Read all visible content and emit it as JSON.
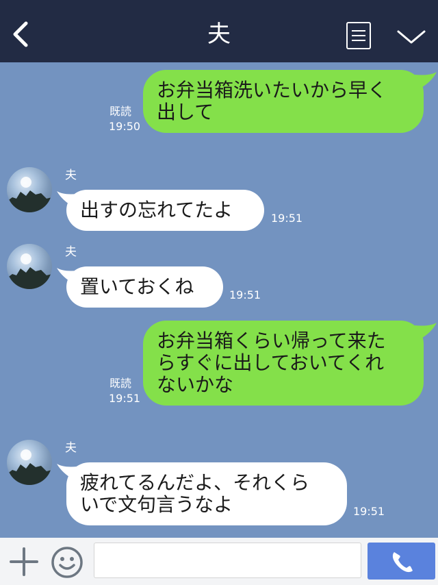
{
  "header": {
    "title": "夫",
    "back_icon": "chevron-left-icon",
    "menu_icon": "list-icon",
    "collapse_icon": "chevron-down-icon",
    "background": "#222b44"
  },
  "messages": [
    {
      "from": "me",
      "text": "お弁当箱洗いたいから早く\n出して",
      "read_label": "既読",
      "time": "19:50"
    },
    {
      "from": "husband",
      "sender": "夫",
      "text": "出すの忘れてたよ",
      "time": "19:51"
    },
    {
      "from": "husband",
      "sender": "夫",
      "text": "置いておくね",
      "time": "19:51"
    },
    {
      "from": "me",
      "text": "お弁当箱くらい帰って来た\nらすぐに出しておいてくれ\nないかな",
      "read_label": "既読",
      "time": "19:51"
    },
    {
      "from": "husband",
      "sender": "夫",
      "text": "疲れてるんだよ、それくら\nいで文句言うなよ",
      "time": "19:51"
    }
  ],
  "input_bar": {
    "plus_icon": "plus-icon",
    "emoji_icon": "smiley-icon",
    "message_value": "",
    "call_icon": "phone-icon"
  },
  "colors": {
    "chat_background": "#7393c0",
    "my_bubble": "#84e04a",
    "their_bubble": "#ffffff",
    "call_button": "#5a82dd"
  }
}
